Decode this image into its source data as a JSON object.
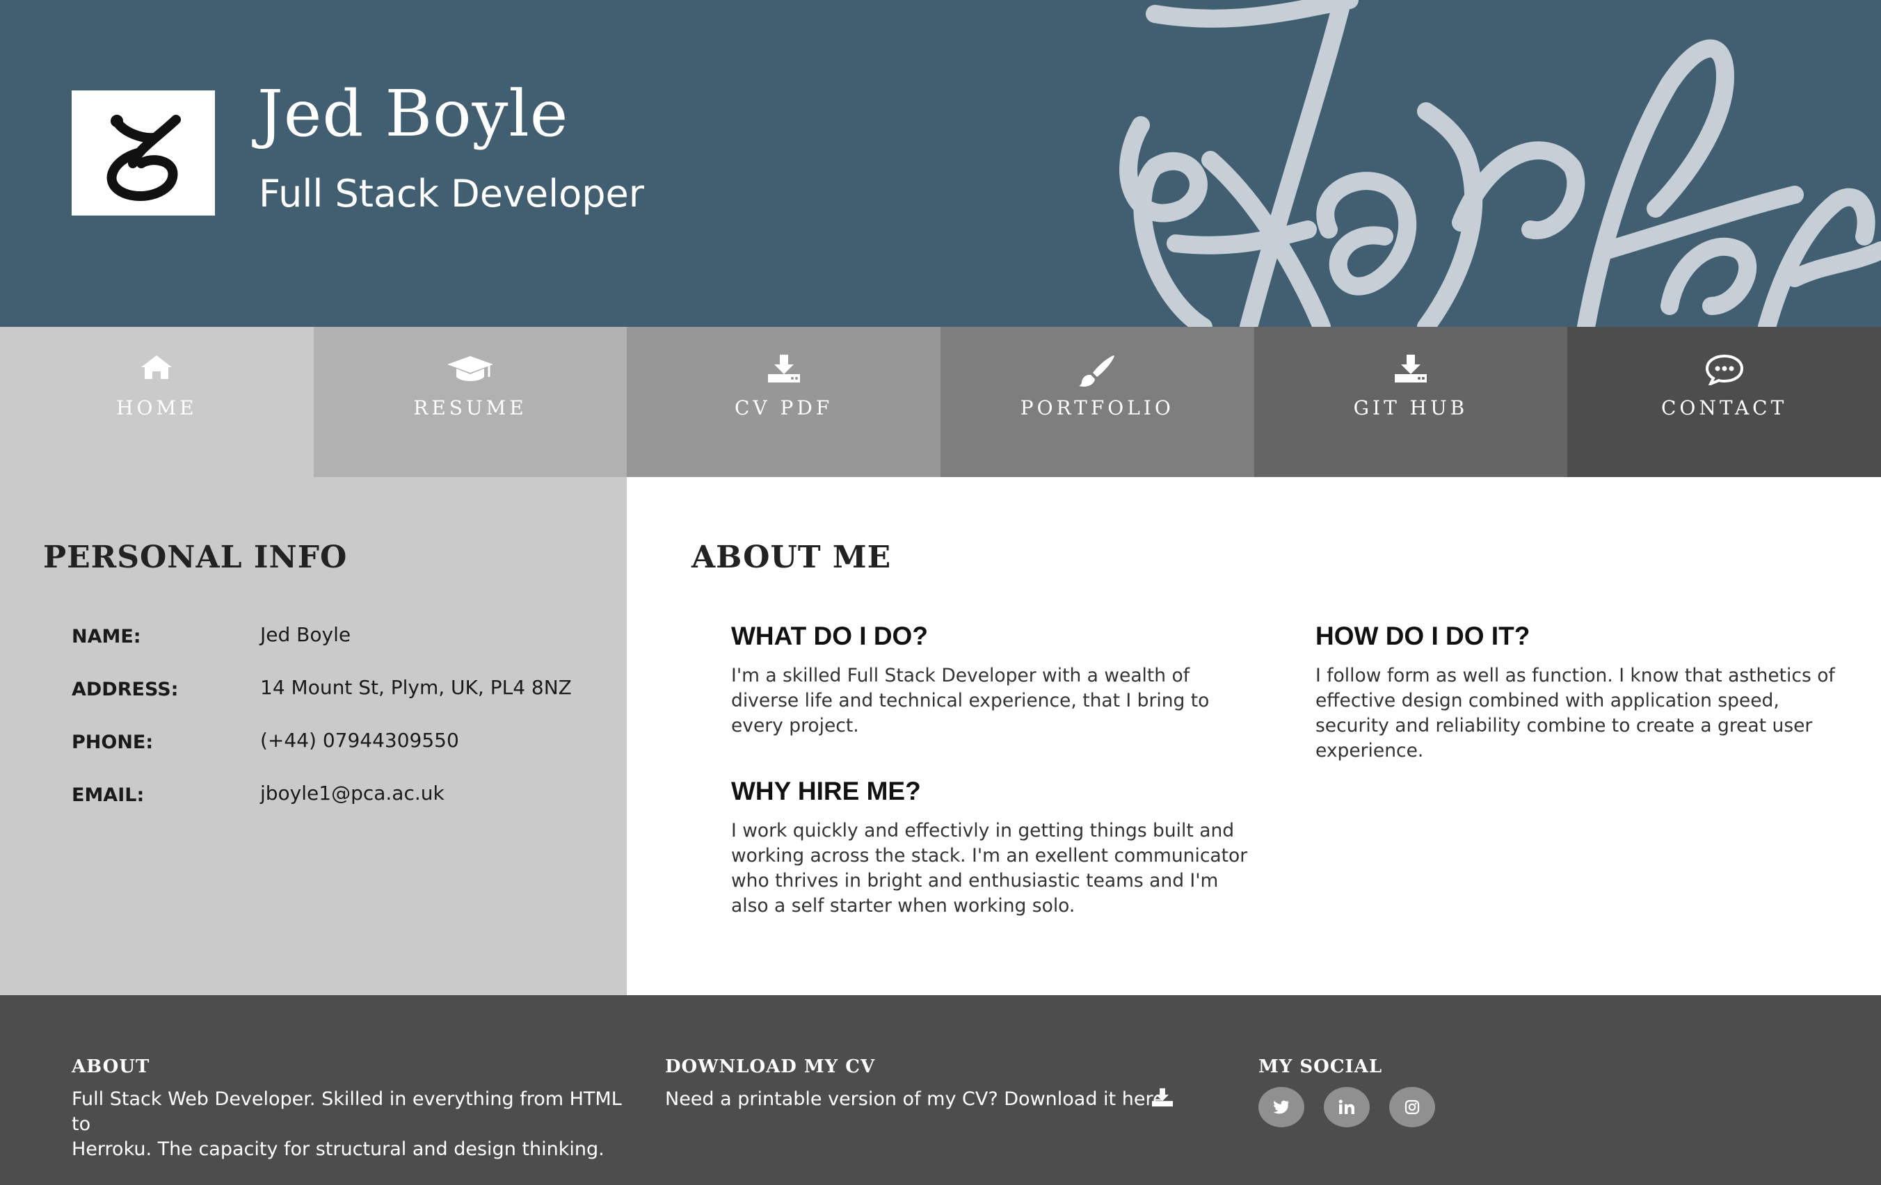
{
  "header": {
    "name": "Jed Boyle",
    "role": "Full Stack Developer",
    "logo_icon": "dog-logo-icon",
    "signature_icon": "signature-graphic",
    "background_color": "#425f71"
  },
  "nav": {
    "items": [
      {
        "label": "HOME",
        "icon": "home-icon",
        "color": "#cacaca"
      },
      {
        "label": "RESUME",
        "icon": "graduation-cap-icon",
        "color": "#b1b1b1"
      },
      {
        "label": "CV PDF",
        "icon": "download-icon",
        "color": "#979797"
      },
      {
        "label": "PORTFOLIO",
        "icon": "paint-brush-icon",
        "color": "#7e7e7e"
      },
      {
        "label": "GIT HUB",
        "icon": "download-icon",
        "color": "#656565"
      },
      {
        "label": "CONTACT",
        "icon": "chat-bubble-icon",
        "color": "#4d4d4d"
      }
    ]
  },
  "personal_info": {
    "title": "PERSONAL INFO",
    "rows": [
      {
        "key": "NAME:",
        "value": "Jed Boyle"
      },
      {
        "key": "ADDRESS:",
        "value": "14 Mount St, Plym, UK, PL4 8NZ"
      },
      {
        "key": "PHONE:",
        "value": "(+44) 07944309550"
      },
      {
        "key": "EMAIL:",
        "value": "jboyle1@pca.ac.uk"
      }
    ]
  },
  "about": {
    "title": "ABOUT ME",
    "what": {
      "title": "WHAT DO I DO?",
      "lines": [
        "I'm a skilled Full Stack Developer with a wealth of",
        "diverse life and technical experience, that I bring to",
        "every project."
      ]
    },
    "why": {
      "title": "WHY HIRE ME?",
      "lines": [
        "I work quickly and effectivly in getting things built and",
        "working across the stack. I'm an exellent communicator",
        "who thrives in bright and enthusiastic teams and I'm",
        "also a self starter when working solo."
      ]
    },
    "how": {
      "title": "HOW DO I DO IT?",
      "lines": [
        "I follow form as well as function. I know that asthetics of",
        "effective design combined with application speed,",
        "security and reliability combine to create a great user",
        "experience."
      ]
    }
  },
  "footer": {
    "about_title": "ABOUT",
    "about_lines": [
      "Full Stack Web Developer. Skilled in everything from HTML to",
      "Herroku. The capacity for structural and design thinking."
    ],
    "cv_title": "DOWNLOAD MY CV",
    "cv_text": "Need a printable version of my CV? Download it here.",
    "social_title": "MY SOCIAL",
    "social": [
      "twitter-icon",
      "linkedin-icon",
      "instagram-icon"
    ]
  }
}
